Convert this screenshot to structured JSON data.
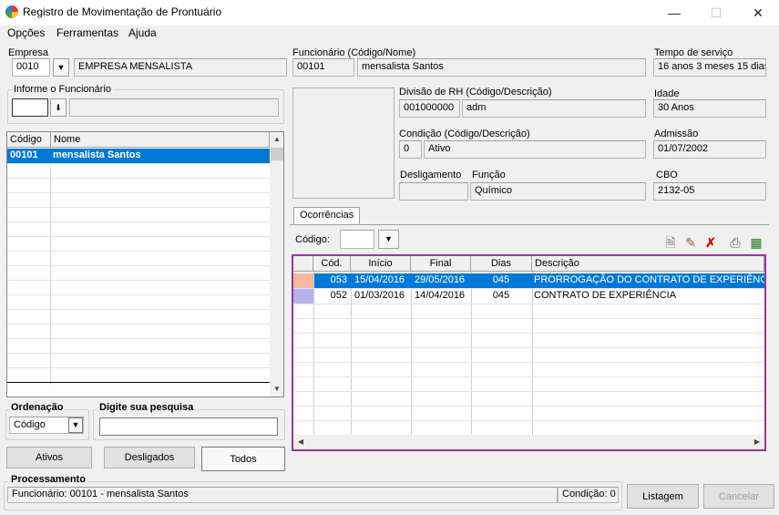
{
  "window": {
    "title": "Registro de Movimentação de Prontuário"
  },
  "menu": [
    "Opções",
    "Ferramentas",
    "Ajuda"
  ],
  "empresa": {
    "label": "Empresa",
    "code": "0010",
    "name": "EMPRESA MENSALISTA"
  },
  "funcionario": {
    "label": "Funcionário (Código/Nome)",
    "code": "00101",
    "name": "mensalista Santos"
  },
  "tempo_servico": {
    "label": "Tempo de serviço",
    "value": "16 anos 3 meses 15 dias"
  },
  "informe": {
    "label": "Informe o Funcionário",
    "value": ""
  },
  "divisao": {
    "label": "Divisão de RH (Código/Descrição)",
    "code": "001000000",
    "desc": "adm"
  },
  "idade": {
    "label": "Idade",
    "value": "30 Anos"
  },
  "condicao": {
    "label": "Condição (Código/Descrição)",
    "code": "0",
    "desc": "Ativo"
  },
  "admissao": {
    "label": "Admissão",
    "value": "01/07/2002"
  },
  "desligamento": {
    "label": "Desligamento",
    "value": ""
  },
  "funcao": {
    "label": "Função",
    "value": "Químico"
  },
  "cbo": {
    "label": "CBO",
    "value": "2132-05"
  },
  "emp_grid": {
    "headers": [
      "Código",
      "Nome"
    ],
    "rows": [
      {
        "code": "00101",
        "name": "mensalista Santos"
      }
    ]
  },
  "ordenacao": {
    "label": "Ordenação",
    "value": "Código"
  },
  "pesquisa": {
    "label": "Digite sua pesquisa",
    "value": ""
  },
  "filters": {
    "ativos": "Ativos",
    "desligados": "Desligados",
    "todos": "Todos"
  },
  "ocorrencias": {
    "tab": "Ocorrências",
    "codigo_label": "Código:",
    "headers": [
      "Cód.",
      "Início",
      "Final",
      "Dias",
      "Descrição"
    ],
    "rows": [
      {
        "color": "#f5b89a",
        "cod": "053",
        "inicio": "15/04/2016",
        "final": "29/05/2016",
        "dias": "045",
        "desc": "PRORROGAÇÃO DO CONTRATO DE EXPERIÊNCIA"
      },
      {
        "color": "#b7b3ea",
        "cod": "052",
        "inicio": "01/03/2016",
        "final": "14/04/2016",
        "dias": "045",
        "desc": "CONTRATO DE EXPERIÊNCIA"
      }
    ]
  },
  "processamento": {
    "label": "Processamento",
    "status": "Funcionário: 00101 - mensalista Santos",
    "condicao": "Condição: 0"
  },
  "buttons": {
    "listagem": "Listagem",
    "cancelar": "Cancelar"
  }
}
